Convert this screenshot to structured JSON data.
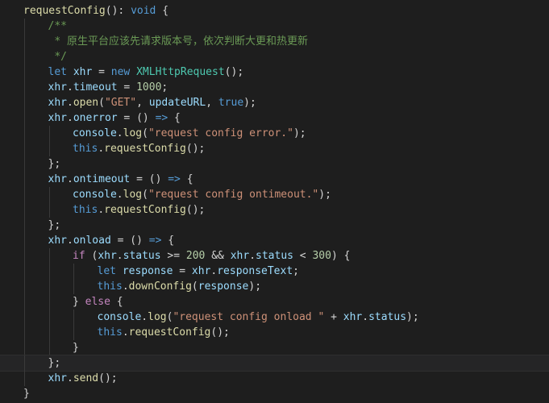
{
  "editor": {
    "language": "typescript",
    "theme_background": "#1e1e1e",
    "current_line_index": 23,
    "lines": [
      {
        "indent": 0,
        "tokens": [
          [
            "fn",
            "requestConfig"
          ],
          [
            "pun",
            "(): "
          ],
          [
            "kw",
            "void"
          ],
          [
            "pun",
            " {"
          ]
        ]
      },
      {
        "indent": 1,
        "tokens": [
          [
            "com",
            "/**"
          ]
        ]
      },
      {
        "indent": 1,
        "tokens": [
          [
            "com",
            " * 原生平台应该先请求版本号，依次判断大更和热更新"
          ]
        ]
      },
      {
        "indent": 1,
        "tokens": [
          [
            "com",
            " */"
          ]
        ]
      },
      {
        "indent": 1,
        "tokens": [
          [
            "kw",
            "let"
          ],
          [
            "pun",
            " "
          ],
          [
            "var",
            "xhr"
          ],
          [
            "pun",
            " = "
          ],
          [
            "kw",
            "new"
          ],
          [
            "pun",
            " "
          ],
          [
            "type",
            "XMLHttpRequest"
          ],
          [
            "pun",
            "();"
          ]
        ]
      },
      {
        "indent": 1,
        "tokens": [
          [
            "var",
            "xhr"
          ],
          [
            "pun",
            "."
          ],
          [
            "var",
            "timeout"
          ],
          [
            "pun",
            " = "
          ],
          [
            "num",
            "1000"
          ],
          [
            "pun",
            ";"
          ]
        ]
      },
      {
        "indent": 1,
        "tokens": [
          [
            "var",
            "xhr"
          ],
          [
            "pun",
            "."
          ],
          [
            "fn",
            "open"
          ],
          [
            "pun",
            "("
          ],
          [
            "str",
            "\"GET\""
          ],
          [
            "pun",
            ", "
          ],
          [
            "var",
            "updateURL"
          ],
          [
            "pun",
            ", "
          ],
          [
            "bool",
            "true"
          ],
          [
            "pun",
            ");"
          ]
        ]
      },
      {
        "indent": 1,
        "tokens": [
          [
            "var",
            "xhr"
          ],
          [
            "pun",
            "."
          ],
          [
            "var",
            "onerror"
          ],
          [
            "pun",
            " = () "
          ],
          [
            "kw",
            "=>"
          ],
          [
            "pun",
            " {"
          ]
        ]
      },
      {
        "indent": 2,
        "tokens": [
          [
            "var",
            "console"
          ],
          [
            "pun",
            "."
          ],
          [
            "fn",
            "log"
          ],
          [
            "pun",
            "("
          ],
          [
            "str",
            "\"request config error.\""
          ],
          [
            "pun",
            ");"
          ]
        ]
      },
      {
        "indent": 2,
        "tokens": [
          [
            "kw",
            "this"
          ],
          [
            "pun",
            "."
          ],
          [
            "fn",
            "requestConfig"
          ],
          [
            "pun",
            "();"
          ]
        ]
      },
      {
        "indent": 1,
        "tokens": [
          [
            "pun",
            "};"
          ]
        ]
      },
      {
        "indent": 1,
        "tokens": [
          [
            "var",
            "xhr"
          ],
          [
            "pun",
            "."
          ],
          [
            "var",
            "ontimeout"
          ],
          [
            "pun",
            " = () "
          ],
          [
            "kw",
            "=>"
          ],
          [
            "pun",
            " {"
          ]
        ]
      },
      {
        "indent": 2,
        "tokens": [
          [
            "var",
            "console"
          ],
          [
            "pun",
            "."
          ],
          [
            "fn",
            "log"
          ],
          [
            "pun",
            "("
          ],
          [
            "str",
            "\"request config ontimeout.\""
          ],
          [
            "pun",
            ");"
          ]
        ]
      },
      {
        "indent": 2,
        "tokens": [
          [
            "kw",
            "this"
          ],
          [
            "pun",
            "."
          ],
          [
            "fn",
            "requestConfig"
          ],
          [
            "pun",
            "();"
          ]
        ]
      },
      {
        "indent": 1,
        "tokens": [
          [
            "pun",
            "};"
          ]
        ]
      },
      {
        "indent": 1,
        "tokens": [
          [
            "var",
            "xhr"
          ],
          [
            "pun",
            "."
          ],
          [
            "var",
            "onload"
          ],
          [
            "pun",
            " = () "
          ],
          [
            "kw",
            "=>"
          ],
          [
            "pun",
            " {"
          ]
        ]
      },
      {
        "indent": 2,
        "tokens": [
          [
            "ctrl",
            "if"
          ],
          [
            "pun",
            " ("
          ],
          [
            "var",
            "xhr"
          ],
          [
            "pun",
            "."
          ],
          [
            "var",
            "status"
          ],
          [
            "pun",
            " >= "
          ],
          [
            "num",
            "200"
          ],
          [
            "pun",
            " && "
          ],
          [
            "var",
            "xhr"
          ],
          [
            "pun",
            "."
          ],
          [
            "var",
            "status"
          ],
          [
            "pun",
            " < "
          ],
          [
            "num",
            "300"
          ],
          [
            "pun",
            ") {"
          ]
        ]
      },
      {
        "indent": 3,
        "tokens": [
          [
            "kw",
            "let"
          ],
          [
            "pun",
            " "
          ],
          [
            "var",
            "response"
          ],
          [
            "pun",
            " = "
          ],
          [
            "var",
            "xhr"
          ],
          [
            "pun",
            "."
          ],
          [
            "var",
            "responseText"
          ],
          [
            "pun",
            ";"
          ]
        ]
      },
      {
        "indent": 3,
        "tokens": [
          [
            "kw",
            "this"
          ],
          [
            "pun",
            "."
          ],
          [
            "fn",
            "downConfig"
          ],
          [
            "pun",
            "("
          ],
          [
            "var",
            "response"
          ],
          [
            "pun",
            ");"
          ]
        ]
      },
      {
        "indent": 2,
        "tokens": [
          [
            "pun",
            "} "
          ],
          [
            "ctrl",
            "else"
          ],
          [
            "pun",
            " {"
          ]
        ]
      },
      {
        "indent": 3,
        "tokens": [
          [
            "var",
            "console"
          ],
          [
            "pun",
            "."
          ],
          [
            "fn",
            "log"
          ],
          [
            "pun",
            "("
          ],
          [
            "str",
            "\"request config onload \""
          ],
          [
            "pun",
            " + "
          ],
          [
            "var",
            "xhr"
          ],
          [
            "pun",
            "."
          ],
          [
            "var",
            "status"
          ],
          [
            "pun",
            ");"
          ]
        ]
      },
      {
        "indent": 3,
        "tokens": [
          [
            "kw",
            "this"
          ],
          [
            "pun",
            "."
          ],
          [
            "fn",
            "requestConfig"
          ],
          [
            "pun",
            "();"
          ]
        ]
      },
      {
        "indent": 2,
        "tokens": [
          [
            "pun",
            "}"
          ]
        ]
      },
      {
        "indent": 1,
        "tokens": [
          [
            "pun",
            "};"
          ]
        ]
      },
      {
        "indent": 1,
        "tokens": [
          [
            "var",
            "xhr"
          ],
          [
            "pun",
            "."
          ],
          [
            "fn",
            "send"
          ],
          [
            "pun",
            "();"
          ]
        ]
      },
      {
        "indent": 0,
        "tokens": [
          [
            "pun",
            "}"
          ]
        ]
      }
    ]
  }
}
